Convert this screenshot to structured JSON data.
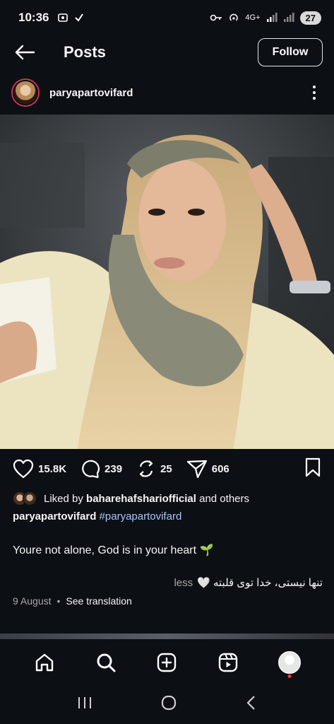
{
  "status_bar": {
    "time": "10:36",
    "network": "4G+",
    "battery": "27"
  },
  "header": {
    "title": "Posts",
    "follow_label": "Follow"
  },
  "post": {
    "author": "paryapartovifard",
    "actions": {
      "likes": "15.8K",
      "comments": "239",
      "reposts": "25",
      "shares": "606"
    },
    "liked_by_prefix": "Liked by",
    "liked_by_user": "baharehafshariofficial",
    "liked_by_suffix": "and others",
    "caption_user": "paryapartovifard",
    "caption_hashtag": "#paryapartovifard",
    "caption_text": "Youre not alone, God is in your heart 🌱",
    "caption_persian": "تنها نیستی، خدا توی قلبته 🤍",
    "less_label": "less",
    "date": "9 August",
    "see_translation": "See translation"
  },
  "colors": {
    "background": "#0c1014",
    "hashtag": "#a7c6ff",
    "muted": "#a8a8a8",
    "notification_dot": "#ff3040"
  },
  "icons": [
    "back-arrow-icon",
    "more-vertical-icon",
    "heart-icon",
    "comment-icon",
    "repost-icon",
    "send-icon",
    "bookmark-icon",
    "home-icon",
    "search-icon",
    "create-icon",
    "reels-icon",
    "profile-icon"
  ]
}
